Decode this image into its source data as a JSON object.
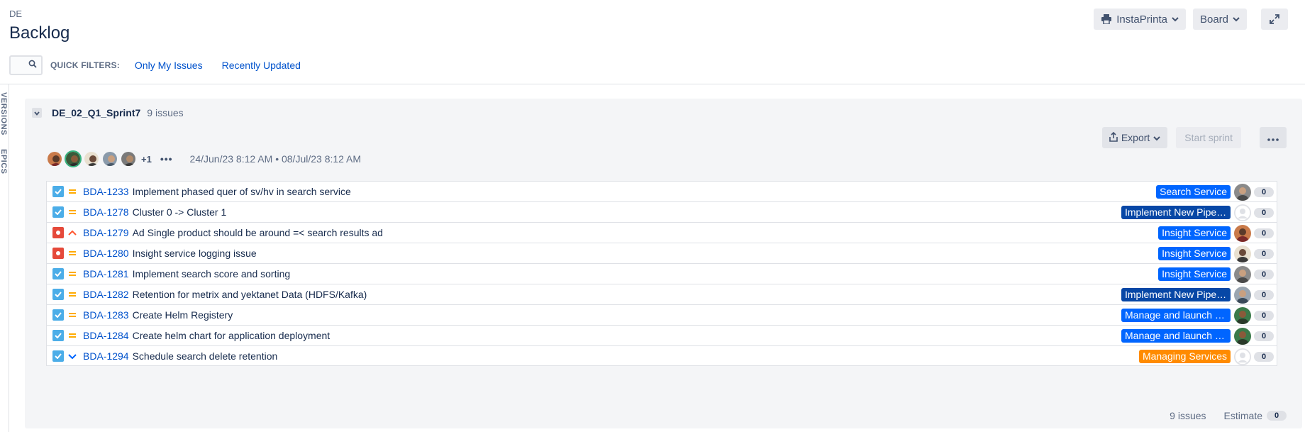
{
  "header": {
    "project_key": "DE",
    "title": "Backlog",
    "board_selector": "InstaPrinta",
    "view_selector": "Board"
  },
  "quick_filters": {
    "label": "QUICK FILTERS:",
    "items": [
      "Only My Issues",
      "Recently Updated"
    ]
  },
  "side_tabs": [
    "VERSIONS",
    "EPICS"
  ],
  "sprint": {
    "name": "DE_02_Q1_Sprint7",
    "issue_count": "9 issues",
    "export_label": "Export",
    "start_label": "Start sprint",
    "extra_assignees": "+1",
    "date_range": "24/Jun/23 8:12 AM • 08/Jul/23 8:12 AM",
    "issues": [
      {
        "key": "BDA-1233",
        "summary": "Implement phased quer of sv/hv in search service",
        "type": "task",
        "priority": "medium",
        "epic": "Search Service",
        "epic_color": "#0065ff",
        "avatar": "person-a",
        "estimate": "0"
      },
      {
        "key": "BDA-1278",
        "summary": "Cluster 0 -> Cluster 1",
        "type": "task",
        "priority": "medium",
        "epic": "Implement New Pipeline",
        "epic_color": "#0747a6",
        "avatar": "none",
        "estimate": "0"
      },
      {
        "key": "BDA-1279",
        "summary": "Ad Single product should be around =< search results ad",
        "type": "bug",
        "priority": "high",
        "epic": "Insight Service",
        "epic_color": "#0065ff",
        "avatar": "person-b",
        "estimate": "0"
      },
      {
        "key": "BDA-1280",
        "summary": "Insight service logging issue",
        "type": "bug",
        "priority": "medium",
        "epic": "Insight Service",
        "epic_color": "#0065ff",
        "avatar": "person-c",
        "estimate": "0"
      },
      {
        "key": "BDA-1281",
        "summary": "Implement search score and sorting",
        "type": "task",
        "priority": "medium",
        "epic": "Insight Service",
        "epic_color": "#0065ff",
        "avatar": "person-a",
        "estimate": "0"
      },
      {
        "key": "BDA-1282",
        "summary": "Retention for metrix and yektanet Data (HDFS/Kafka)",
        "type": "task",
        "priority": "medium",
        "epic": "Implement New Pipeline",
        "epic_color": "#0747a6",
        "avatar": "person-d",
        "estimate": "0"
      },
      {
        "key": "BDA-1283",
        "summary": "Create Helm Registery",
        "type": "task",
        "priority": "medium",
        "epic": "Manage and launch Services",
        "epic_color": "#0065ff",
        "avatar": "person-e",
        "estimate": "0"
      },
      {
        "key": "BDA-1284",
        "summary": "Create helm chart for application deployment",
        "type": "task",
        "priority": "medium",
        "epic": "Manage and launch Services",
        "epic_color": "#0065ff",
        "avatar": "person-e",
        "estimate": "0"
      },
      {
        "key": "BDA-1294",
        "summary": "Schedule search delete retention",
        "type": "task",
        "priority": "low",
        "epic": "Managing Services",
        "epic_color": "#ff8b00",
        "avatar": "none",
        "estimate": "0"
      }
    ],
    "footer": {
      "issues_label": "9 issues",
      "estimate_label": "Estimate",
      "estimate_value": "0"
    }
  },
  "colors": {
    "accent": "#0052cc",
    "task": "#4bade8",
    "bug": "#e5493a",
    "priority_medium": "#ffab00",
    "priority_high": "#ff5630",
    "priority_low": "#0065ff"
  }
}
